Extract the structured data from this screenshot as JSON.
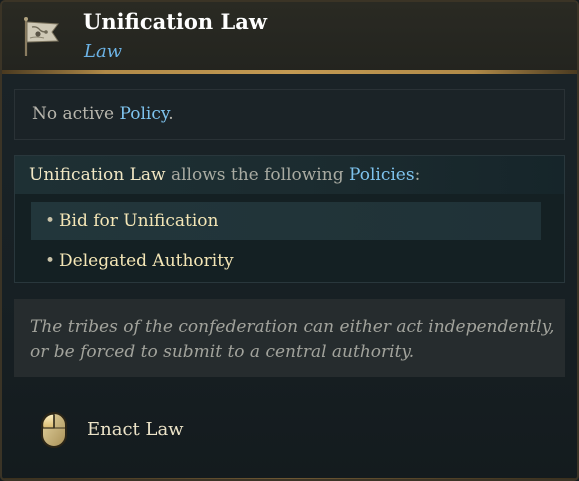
{
  "header": {
    "title": "Unification Law",
    "subtitle": "Law",
    "icon": "banner-flag-icon"
  },
  "status": {
    "prefix": "No active ",
    "keyword": "Policy",
    "suffix": "."
  },
  "policies": {
    "law_name": "Unification Law",
    "middle": " allows the following ",
    "keyword": "Policies",
    "suffix": ":",
    "items": [
      {
        "bullet": "•",
        "label": "Bid for Unification",
        "highlighted": true
      },
      {
        "bullet": "•",
        "label": "Delegated Authority",
        "highlighted": false
      }
    ]
  },
  "description": "The tribes of the confederation can either act independently, or be forced to submit to a central authority.",
  "action": {
    "label": "Enact Law",
    "icon": "mouse-left-click-icon"
  },
  "colors": {
    "title": "#ffffff",
    "subtitle": "#6cb3e6",
    "keyword_blue": "#7ec3ee",
    "keyword_cream": "#f1e7c4",
    "policy_item": "#f4e6b6",
    "gold_divider": "#c39a53"
  }
}
